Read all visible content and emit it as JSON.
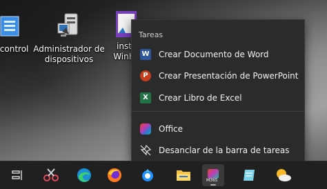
{
  "desktop": {
    "control_panel_label": "e control",
    "device_manager_label_line1": "Administrador de",
    "device_manager_label_line2": "dispositivos",
    "winh_label_line1": "inst",
    "winh_label_line2": "WinH"
  },
  "jumplist": {
    "header": "Tareas",
    "items": [
      {
        "label": "Crear Documento de Word",
        "icon": "word-icon"
      },
      {
        "label": "Crear Presentación de PowerPoint",
        "icon": "powerpoint-icon"
      },
      {
        "label": "Crear Libro de Excel",
        "icon": "excel-icon"
      }
    ],
    "pinned_app": {
      "label": "Office",
      "icon": "office-icon"
    },
    "unpin": {
      "label": "Desanclar de la barra de tareas",
      "icon": "unpin-icon"
    }
  },
  "taskbar": {
    "active_app_badge": "M365",
    "icons": [
      "task-view-icon",
      "snipping-tool-icon",
      "edge-icon",
      "firefox-icon",
      "helper-app-icon",
      "file-explorer-icon",
      "microsoft-365-icon",
      "notepad-icon",
      "weather-icon"
    ]
  },
  "colors": {
    "menu_bg": "#2b2b2b",
    "taskbar_bg": "#202020",
    "word": "#2b579a",
    "powerpoint": "#c43e1c",
    "excel": "#217346"
  }
}
